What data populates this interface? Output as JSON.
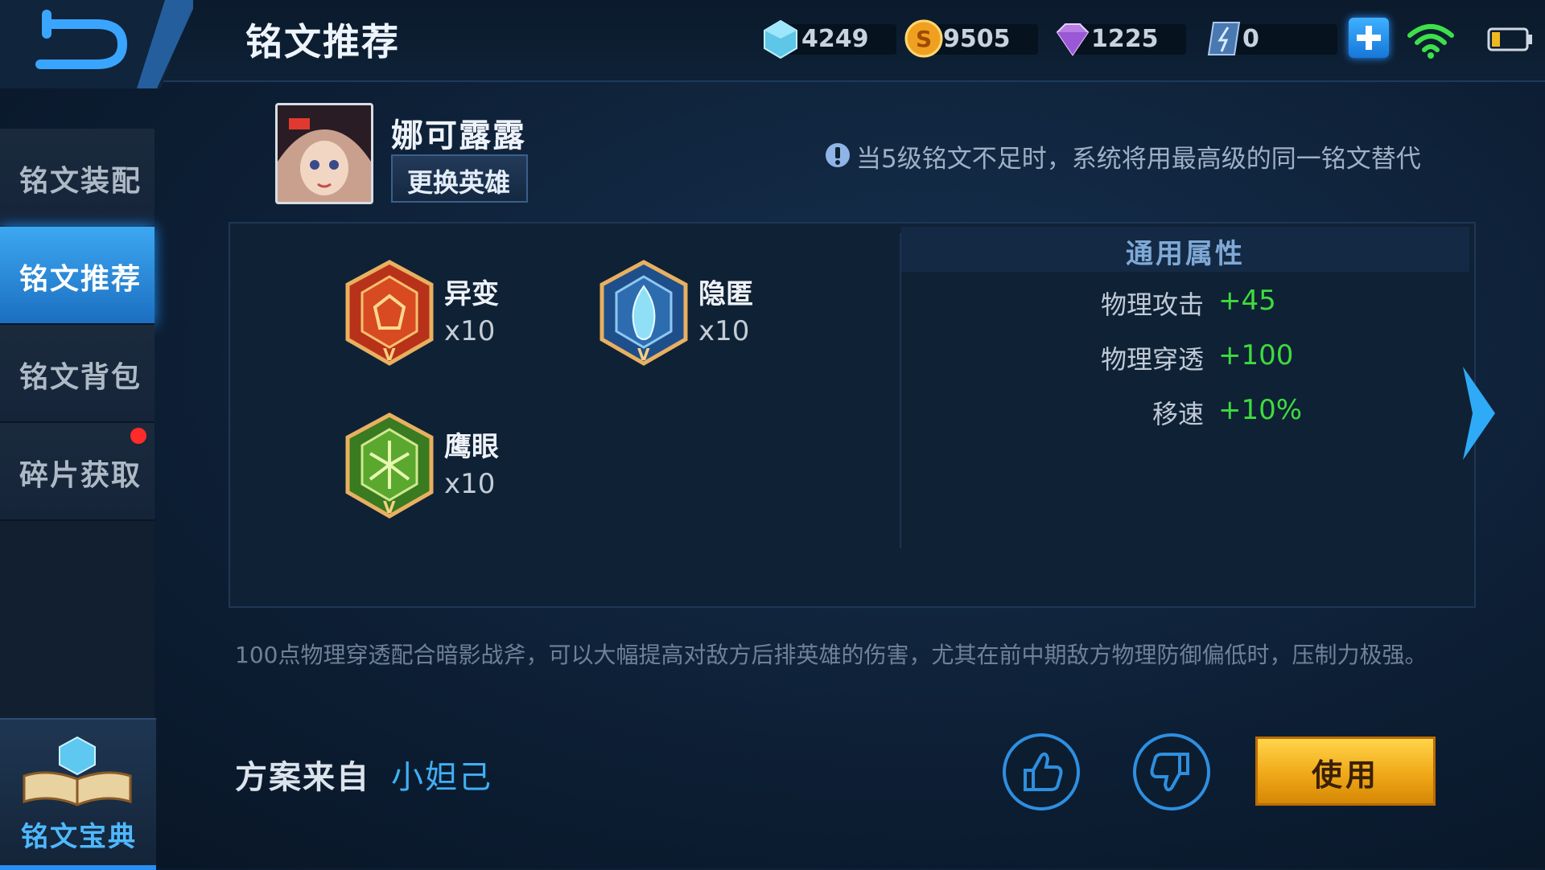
{
  "header": {
    "title": "铭文推荐",
    "resources": [
      {
        "icon": "crystal-icon",
        "value": "4249"
      },
      {
        "icon": "gold-coin-icon",
        "value": "9505"
      },
      {
        "icon": "diamond-icon",
        "value": "1225"
      },
      {
        "icon": "voucher-icon",
        "value": "0"
      }
    ]
  },
  "sidebar": {
    "items": [
      {
        "label": "铭文装配"
      },
      {
        "label": "铭文推荐",
        "active": true
      },
      {
        "label": "铭文背包"
      },
      {
        "label": "碎片获取",
        "badge": "red-dot"
      }
    ],
    "codex_label": "铭文宝典"
  },
  "hero": {
    "name": "娜可露露",
    "change_label": "更换英雄"
  },
  "tip": "当5级铭文不足时，系统将用最高级的同一铭文替代",
  "runes": [
    {
      "name": "异变",
      "count": "x10",
      "color": "#c8401e"
    },
    {
      "name": "隐匿",
      "count": "x10",
      "color": "#2f6fae"
    },
    {
      "name": "鹰眼",
      "count": "x10",
      "color": "#4a9a2a"
    }
  ],
  "attributes": {
    "header": "通用属性",
    "rows": [
      {
        "key": "物理攻击",
        "value": "+45"
      },
      {
        "key": "物理穿透",
        "value": "+100"
      },
      {
        "key": "移速",
        "value": "+10%"
      }
    ]
  },
  "description": "100点物理穿透配合暗影战斧，可以大幅提高对敌方后排英雄的伤害，尤其在前中期敌方物理防御偏低时，压制力极强。",
  "source": {
    "label": "方案来自",
    "author": "小妲己"
  },
  "actions": {
    "use_label": "使用"
  },
  "colors": {
    "accent": "#2a8ff0",
    "positive": "#3ddc3d",
    "use_button": "#f0a818"
  }
}
